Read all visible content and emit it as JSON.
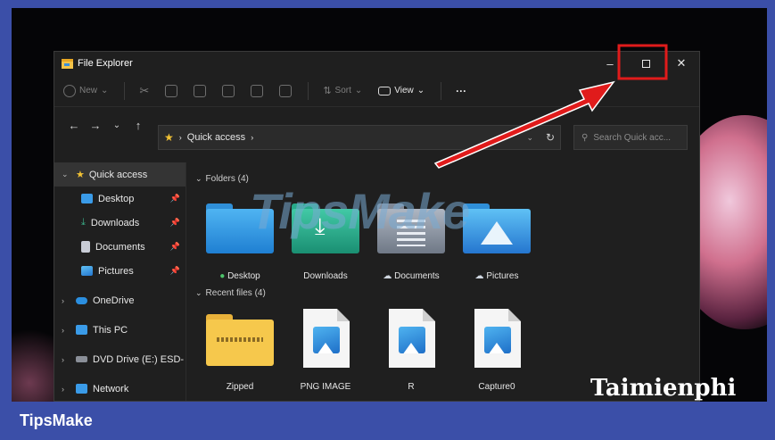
{
  "window": {
    "title": "File Explorer",
    "controls": {
      "minimize": "–",
      "close": "✕"
    }
  },
  "toolbar": {
    "new_label": "New",
    "sort_label": "Sort",
    "view_label": "View",
    "more_label": "···"
  },
  "address": {
    "path": "Quick access",
    "search_placeholder": "Search Quick acc..."
  },
  "sidebar": {
    "items": [
      {
        "label": "Quick access"
      },
      {
        "label": "Desktop"
      },
      {
        "label": "Downloads"
      },
      {
        "label": "Documents"
      },
      {
        "label": "Pictures"
      },
      {
        "label": "OneDrive"
      },
      {
        "label": "This PC"
      },
      {
        "label": "DVD Drive (E:) ESD-"
      },
      {
        "label": "Network"
      }
    ]
  },
  "content": {
    "folders_header": "Folders (4)",
    "folders": [
      {
        "label": "Desktop"
      },
      {
        "label": "Downloads"
      },
      {
        "label": "Documents"
      },
      {
        "label": "Pictures"
      }
    ],
    "recent_header": "Recent files (4)",
    "recent": [
      {
        "label": "Zipped"
      },
      {
        "label": "PNG IMAGE"
      },
      {
        "label": "R"
      },
      {
        "label": "Capture0"
      }
    ]
  },
  "watermarks": {
    "center": "TipsMake",
    "bottom_right": "Taimienphi"
  },
  "footer": {
    "brand": "TipsMake"
  },
  "colors": {
    "frame": "#3b4fa8",
    "highlight": "#e01b1b",
    "accent": "#f2c234"
  }
}
